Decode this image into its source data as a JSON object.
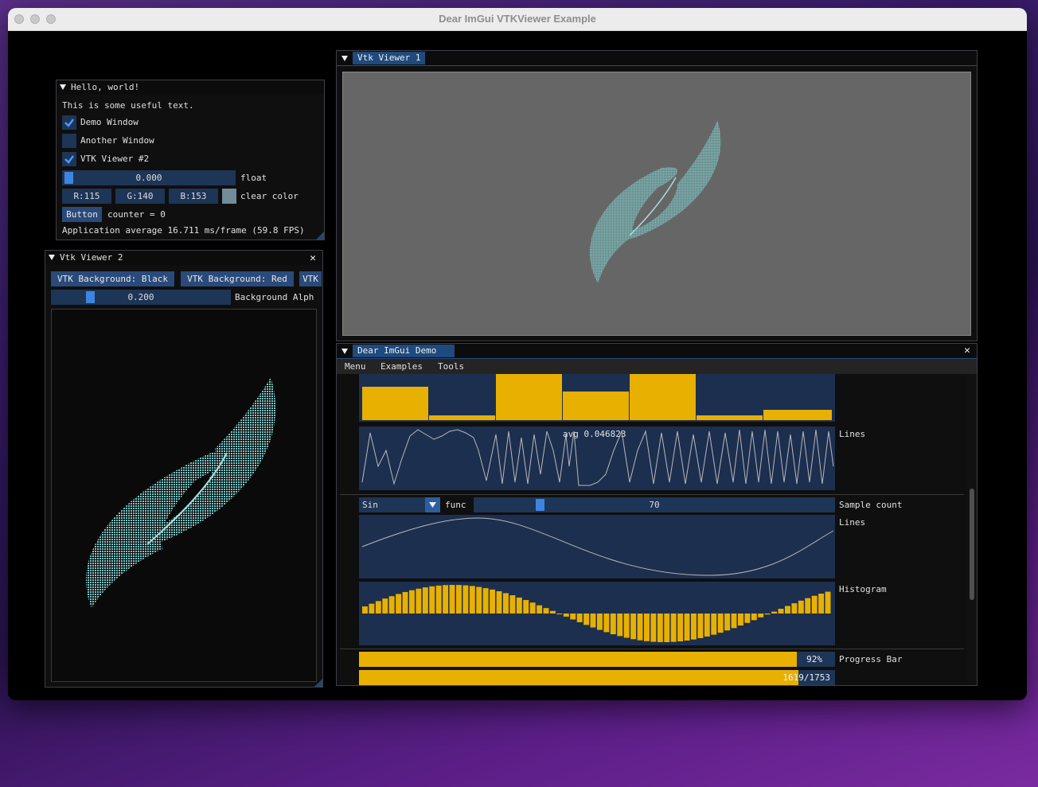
{
  "window": {
    "title": "Dear ImGui VTKViewer Example"
  },
  "hello": {
    "title": "Hello, world!",
    "text": "This is some useful text.",
    "checks": [
      {
        "label": "Demo Window",
        "checked": true
      },
      {
        "label": "Another Window",
        "checked": false
      },
      {
        "label": "VTK Viewer #2",
        "checked": true
      }
    ],
    "slider_value": "0.000",
    "slider_label": "float",
    "color_r": "R:115",
    "color_g": "G:140",
    "color_b": "B:153",
    "color_label": "clear color",
    "swatch": "#738c99",
    "button": "Button",
    "counter": "counter = 0",
    "fps": "Application average 16.711 ms/frame (59.8 FPS)"
  },
  "viewer2": {
    "title": "Vtk Viewer 2",
    "buttons": [
      "VTK Background: Black",
      "VTK Background: Red",
      "VTK"
    ],
    "alpha_value": "0.200",
    "alpha_label": "Background Alph"
  },
  "viewer1": {
    "title": "Vtk Viewer 1"
  },
  "demo": {
    "title": "Dear ImGui Demo",
    "menu": [
      "Menu",
      "Examples",
      "Tools"
    ],
    "lines_label": "Lines",
    "lines_overlay": "avg 0.046823",
    "combo_value": "Sin",
    "combo_label": "func",
    "sample_value": "70",
    "sample_label": "Sample count",
    "lines2_label": "Lines",
    "hist_label": "Histogram",
    "progress_text": "92%",
    "progress_label": "Progress Bar",
    "progress_fraction": 0.92,
    "progress2_text": "1619/1753",
    "progress2_fraction": 0.9236
  },
  "colors": {
    "accent": "#3d85e0",
    "frame": "#1d3557",
    "plot": "#e8b000",
    "point_cloud": "#7cc4c4",
    "vtk_bg1": "#666666",
    "vtk_bg2": "#0a0a0a"
  }
}
